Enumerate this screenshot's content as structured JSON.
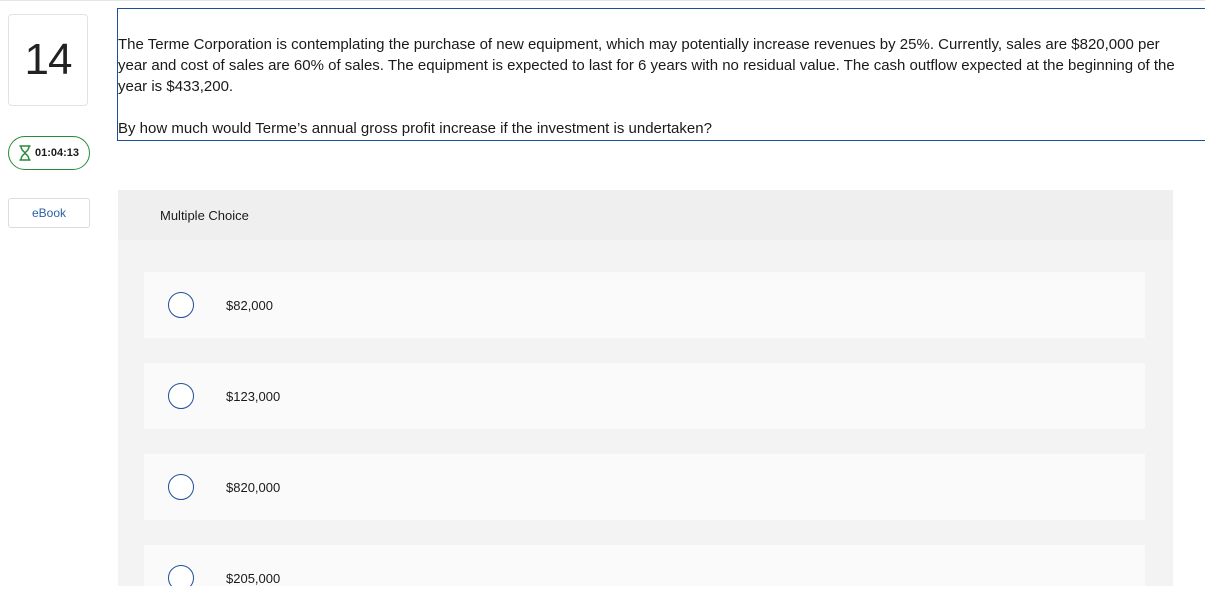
{
  "question": {
    "number": "14",
    "paragraph": "The Terme Corporation is contemplating the purchase of new equipment, which may potentially increase revenues by 25%. Currently, sales are $820,000 per year and cost of sales are 60% of sales. The equipment is expected to last for 6 years with no residual value. The cash outflow expected at the beginning of the year is $433,200.",
    "ask": "By how much would Terme’s annual gross profit increase if the investment is undertaken?"
  },
  "timer": {
    "value": "01:04:13",
    "icon": "hourglass-icon"
  },
  "ebook": {
    "label": "eBook"
  },
  "choices_section": {
    "header": "Multiple Choice",
    "options": [
      "$82,000",
      "$123,000",
      "$820,000",
      "$205,000"
    ]
  },
  "colors": {
    "accent_blue": "#1f4f9a",
    "timer_green": "#2a8a3a",
    "link_blue": "#2b5fa8"
  }
}
